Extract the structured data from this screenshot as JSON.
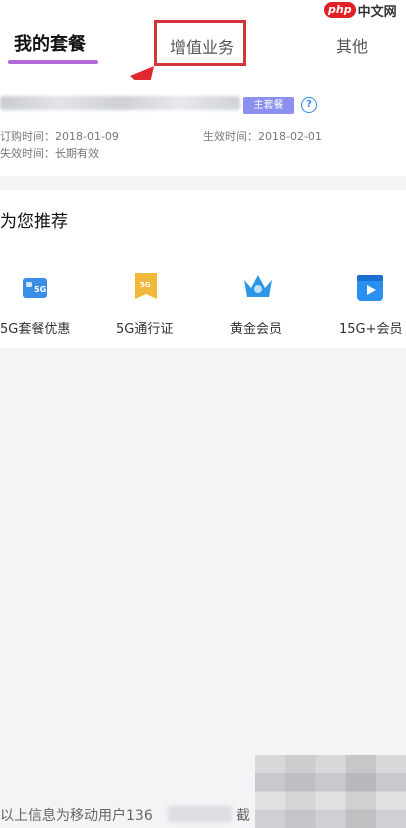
{
  "tabs": {
    "my_package": "我的套餐",
    "value_added": "增值业务",
    "other": "其他"
  },
  "watermark": {
    "php": "php",
    "cn": "中文网"
  },
  "package": {
    "badge": "主套餐",
    "order_time_label": "订购时间：2018-01-09",
    "effective_time_label": "生效时间：2018-02-01",
    "expire_time_label": "失效时间：长期有效"
  },
  "recommend": {
    "title": "为您推荐",
    "items": [
      {
        "label": "5G套餐优惠",
        "icon": "sim-5g-icon",
        "color": "#3a8ee6"
      },
      {
        "label": "5G通行证",
        "icon": "5g-pass-icon",
        "color": "#f0b93a"
      },
      {
        "label": "黄金会员",
        "icon": "crown-icon",
        "color": "#2b97e6"
      },
      {
        "label": "15G+会员",
        "icon": "video-play-icon",
        "color": "#2b8fef"
      }
    ]
  },
  "footer": {
    "text": "以上信息为移动用户136",
    "tail": "截"
  },
  "colors": {
    "accent": "#b26ad6",
    "highlight": "#d4353d",
    "badge": "#8a8ff0",
    "link": "#2d8df2"
  }
}
